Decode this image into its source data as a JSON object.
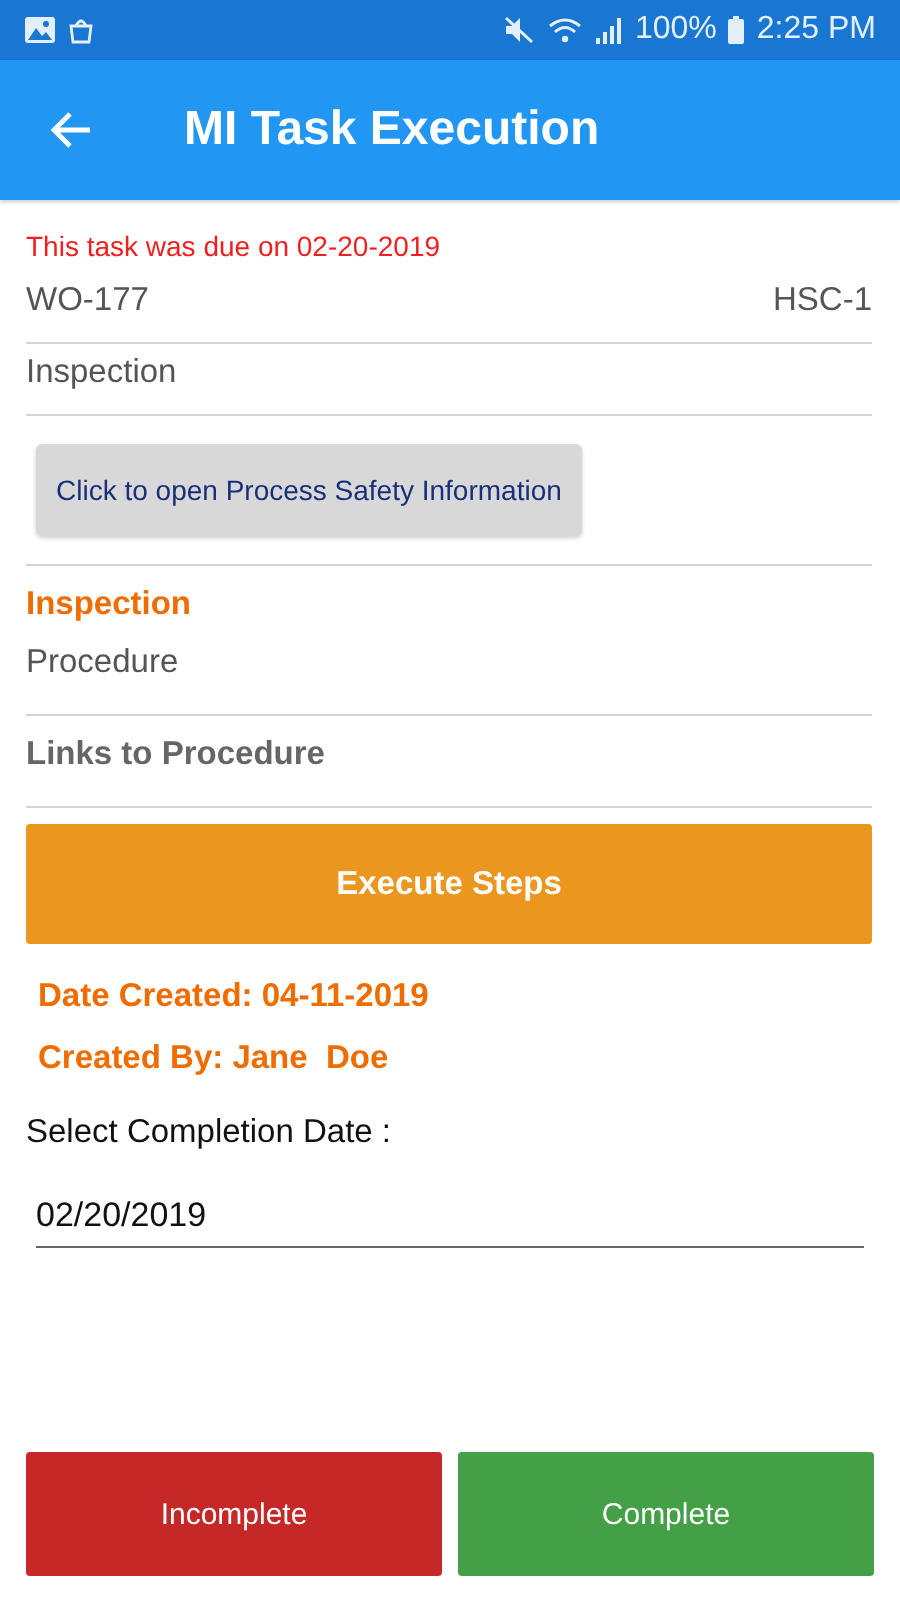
{
  "status_bar": {
    "battery": "100%",
    "time": "2:25 PM"
  },
  "app_bar": {
    "title": "MI Task Execution"
  },
  "due_notice": "This task was due on 02-20-2019",
  "work_order": {
    "id": "WO-177",
    "code": "HSC-1"
  },
  "task_type": "Inspection",
  "psi_button": "Click to open Process Safety Information",
  "section_title": "Inspection",
  "procedure": "Procedure",
  "links_label": "Links to Procedure",
  "execute_button": "Execute Steps",
  "date_created": "Date Created: 04-11-2019",
  "created_by": "Created By: Jane  Doe",
  "completion_label": "Select Completion Date :",
  "completion_date": "02/20/2019",
  "actions": [
    {
      "label": "Incomplete",
      "kind": "negative"
    },
    {
      "label": "Complete",
      "kind": "positive"
    }
  ]
}
